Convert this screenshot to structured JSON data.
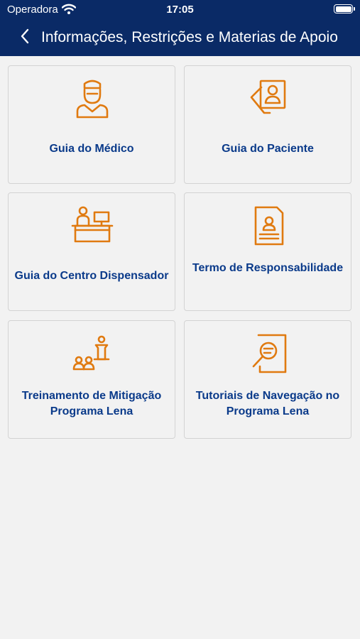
{
  "status": {
    "carrier": "Operadora",
    "time": "17:05"
  },
  "nav": {
    "title": "Informações, Restrições e Materias de Apoio"
  },
  "cards": [
    {
      "label": "Guia do Médico",
      "icon": "doctor-icon"
    },
    {
      "label": "Guia do Paciente",
      "icon": "patient-profile-icon"
    },
    {
      "label": "Guia do Centro Dispensador",
      "icon": "reception-desk-icon"
    },
    {
      "label": "Termo de Responsabilidade",
      "icon": "document-icon"
    },
    {
      "label": "Treinamento de Mitigação Programa Lena",
      "icon": "training-icon"
    },
    {
      "label": "Tutoriais de Navegação no Programa Lena",
      "icon": "search-document-icon"
    }
  ],
  "colors": {
    "header": "#0a2a66",
    "label": "#0a3a8a",
    "icon": "#e07a10",
    "background": "#f2f2f2"
  }
}
